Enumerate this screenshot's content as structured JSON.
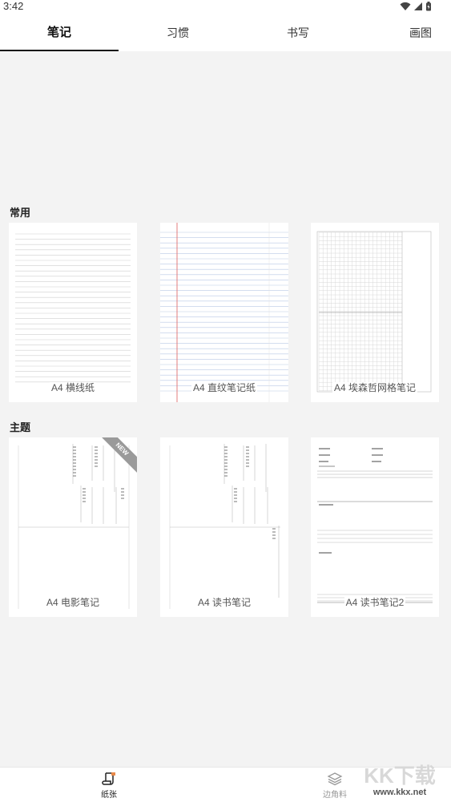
{
  "status_bar": {
    "time": "3:42"
  },
  "tabs": [
    {
      "label": "笔记",
      "active": true
    },
    {
      "label": "习惯",
      "active": false
    },
    {
      "label": "书写",
      "active": false
    },
    {
      "label": "画图",
      "active": false
    }
  ],
  "sections": {
    "common": {
      "title": "常用",
      "cards": [
        {
          "label": "A4 横线纸",
          "icon": "ruled-paper-thumbnail"
        },
        {
          "label": "A4 直纹笔记纸",
          "icon": "lined-notebook-thumbnail"
        },
        {
          "label": "A4 埃森哲网格笔记",
          "icon": "grid-paper-thumbnail"
        }
      ]
    },
    "theme": {
      "title": "主题",
      "cards": [
        {
          "label": "A4 电影笔记",
          "icon": "movie-notes-thumbnail",
          "badge": "NEW"
        },
        {
          "label": "A4 读书笔记",
          "icon": "reading-notes-thumbnail"
        },
        {
          "label": "A4 读书笔记2",
          "icon": "reading-notes-2-thumbnail"
        }
      ]
    }
  },
  "bottom_nav": [
    {
      "label": "纸张",
      "icon": "paper-icon",
      "active": true
    },
    {
      "label": "边角料",
      "icon": "layers-icon",
      "active": false
    }
  ],
  "watermark": {
    "logo": "KK下载",
    "url": "www.kkx.net"
  },
  "colors": {
    "background": "#f3f3f3",
    "surface": "#ffffff",
    "active_tab": "#111111",
    "margin_red": "#e07070",
    "line_blue": "#b9c9e6"
  }
}
